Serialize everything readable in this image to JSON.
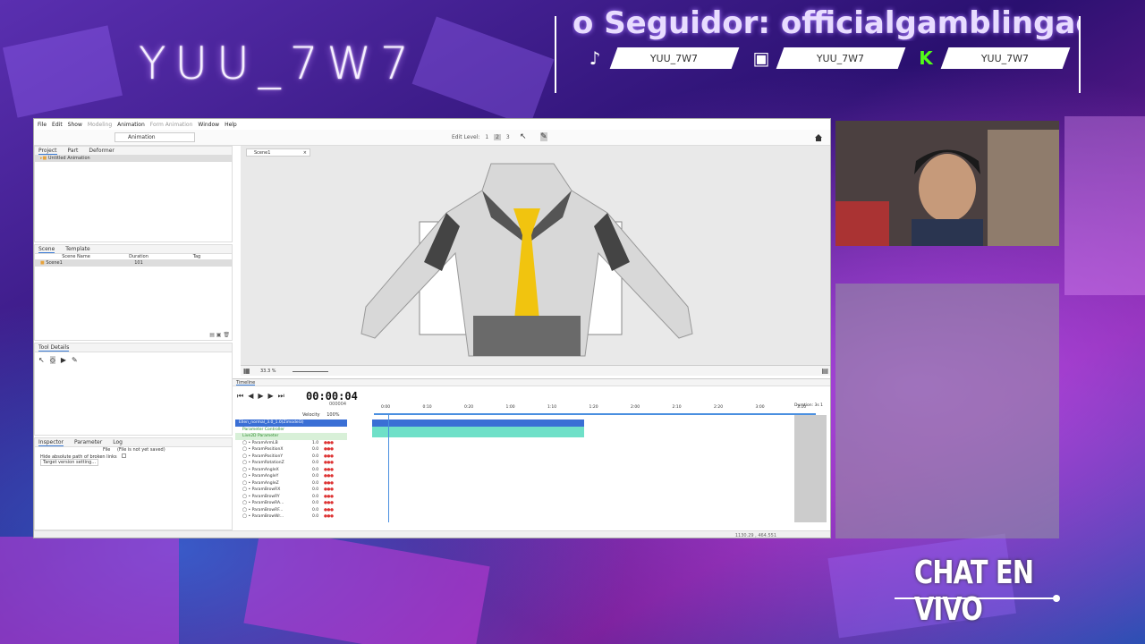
{
  "stream": {
    "streamer_name": "YUU_7W7",
    "ticker_text": "o Seguidor: officialgamblingacac",
    "socials": [
      {
        "platform_icon": "tiktok-icon",
        "handle": "YUU_7W7",
        "glyph": "♪"
      },
      {
        "platform_icon": "twitch-icon",
        "handle": "YUU_7W7",
        "glyph": "▣"
      },
      {
        "platform_icon": "kick-icon",
        "handle": "YUU_7W7",
        "glyph": "K"
      }
    ],
    "chat_label": "CHAT EN VIVO",
    "colors": {
      "kick": "#53fc18",
      "accent": "#b46cff"
    }
  },
  "app": {
    "menu": [
      "File",
      "Edit",
      "Show",
      "Modeling",
      "Animation",
      "Form Animation",
      "Window",
      "Help"
    ],
    "mode": "Animation",
    "edit_level_label": "Edit Level:",
    "edit_levels": [
      "1",
      "2",
      "3"
    ],
    "project_tabs": [
      "Project",
      "Part",
      "Deformer"
    ],
    "project_item": "Untitled Animation",
    "scene_tabs": [
      "Scene",
      "Template"
    ],
    "scene_columns": [
      "Scene Name",
      "Duration",
      "Tag"
    ],
    "scene_row": {
      "name": "Scene1",
      "duration": "101",
      "tag": ""
    },
    "tool_details_label": "Tool Details",
    "inspector_tabs": [
      "Inspector",
      "Parameter",
      "Log"
    ],
    "inspector": {
      "file_label": "File",
      "file_value": "(File is not yet saved)",
      "absolute_path_label": "Hide absolute path of broken links",
      "target_version_label": "Target version setting..."
    },
    "canvas_tab": "Scene1",
    "zoom": "33.3 %",
    "timeline": {
      "label": "Timeline",
      "time": "00:00:04",
      "frame": "000004",
      "velocity_label": "Velocity",
      "velocity_value": "100%",
      "model_track": "Ellen_normal_3.0_1.0(Zimodel3)",
      "groups": [
        "Parameter Controller",
        "Live2D Parameter"
      ],
      "params": [
        {
          "name": "ParamArmLB",
          "value": "1.0"
        },
        {
          "name": "ParamPositionX",
          "value": "0.0"
        },
        {
          "name": "ParamPositionY",
          "value": "0.0"
        },
        {
          "name": "ParamRotationZ",
          "value": "0.0"
        },
        {
          "name": "ParamAngleX",
          "value": "0.0"
        },
        {
          "name": "ParamAngleY",
          "value": "0.0"
        },
        {
          "name": "ParamAngleZ",
          "value": "0.0"
        },
        {
          "name": "ParamBrowRX",
          "value": "0.0"
        },
        {
          "name": "ParamBrowRY",
          "value": "0.0"
        },
        {
          "name": "ParamBrowRA...",
          "value": "0.0"
        },
        {
          "name": "ParamBrowRF...",
          "value": "0.0"
        },
        {
          "name": "ParamBrowWr...",
          "value": "0.0"
        }
      ],
      "ruler_ticks": [
        "0:00",
        "0:10",
        "0:20",
        "1:00",
        "1:10",
        "1:20",
        "2:00",
        "2:10",
        "2:20",
        "3:00",
        "3:10"
      ],
      "duration_label": "Duration: 3s 1"
    },
    "status": "1130.29 , 464.551"
  }
}
